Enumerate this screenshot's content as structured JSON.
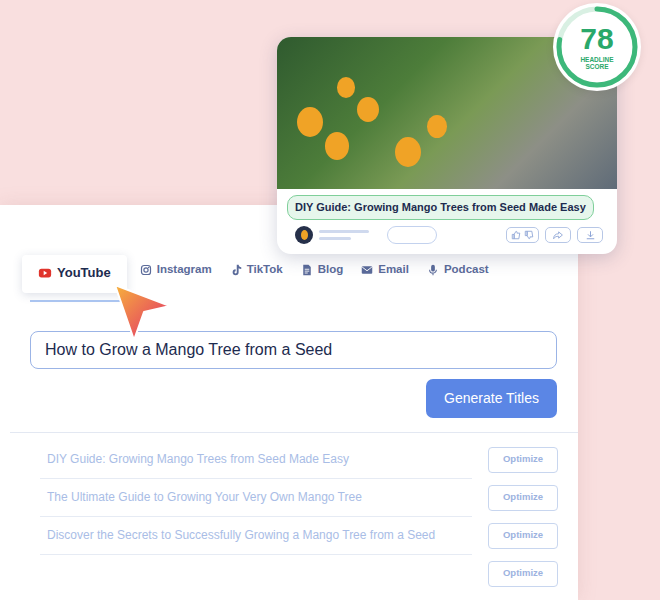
{
  "score": {
    "value": "78",
    "label": "HEADLINE SCORE",
    "level": 0.78
  },
  "preview": {
    "headline": "DIY Guide: Growing Mango Trees from Seed Made Easy"
  },
  "tabs": [
    {
      "label": "YouTube",
      "selected": true
    },
    {
      "label": "Instagram",
      "selected": false
    },
    {
      "label": "TikTok",
      "selected": false
    },
    {
      "label": "Blog",
      "selected": false
    },
    {
      "label": "Email",
      "selected": false
    },
    {
      "label": "Podcast",
      "selected": false
    }
  ],
  "input": {
    "value": "How to Grow a Mango Tree from a Seed"
  },
  "generate_button": "Generate Titles",
  "results": [
    {
      "title": "DIY Guide: Growing Mango Trees from Seed Made Easy",
      "button": "Optimize"
    },
    {
      "title": "The Ultimate Guide to Growing Your Very Own Mango Tree",
      "button": "Optimize"
    },
    {
      "title": "Discover the Secrets to Successfully Growing a Mango Tree from a Seed",
      "button": "Optimize"
    },
    {
      "title": "",
      "button": "Optimize"
    }
  ]
}
